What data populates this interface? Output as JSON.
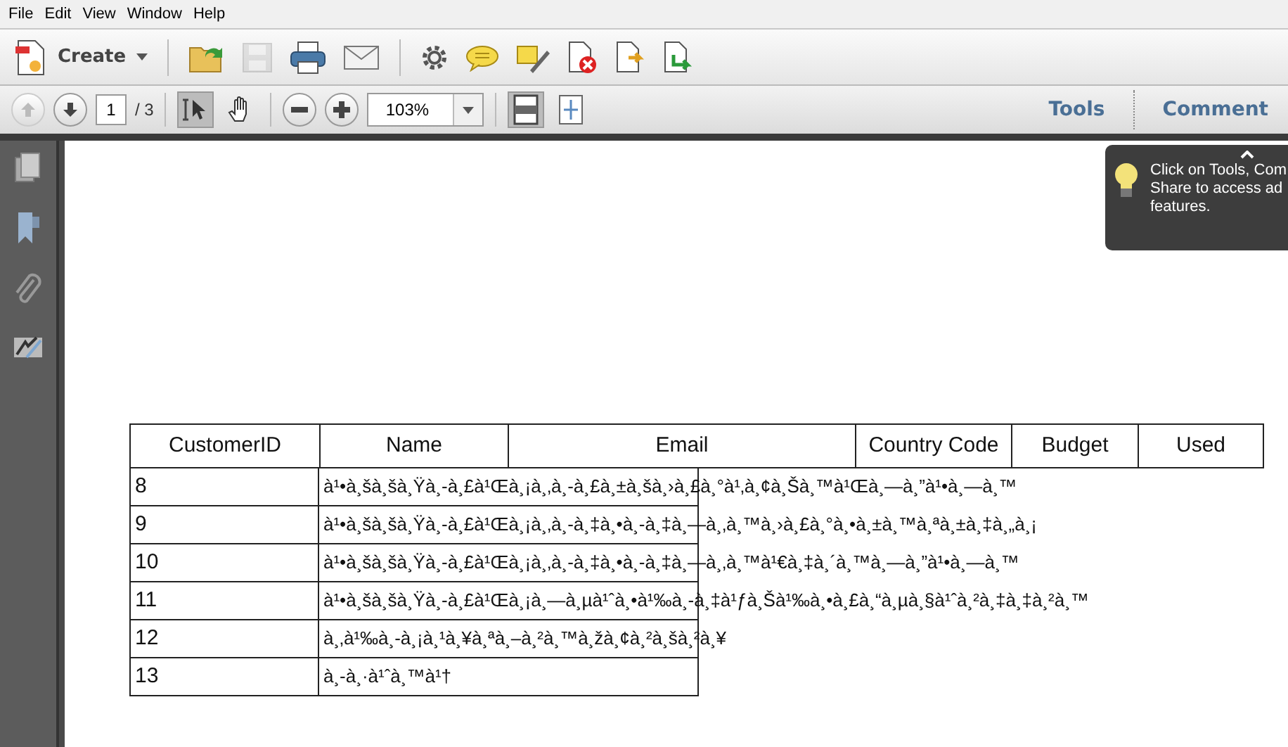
{
  "menu": [
    {
      "label": "File"
    },
    {
      "label": "Edit"
    },
    {
      "label": "View"
    },
    {
      "label": "Window"
    },
    {
      "label": "Help"
    }
  ],
  "toolbar": {
    "create_label": "Create",
    "save": {
      "disabled": true
    }
  },
  "navbar": {
    "prev_page": {
      "disabled": true
    },
    "page_current": "1",
    "page_total": "/ 3",
    "zoom": "103%",
    "tools": [
      {
        "kind": "select",
        "selected": true
      },
      {
        "kind": "hand",
        "selected": false
      }
    ],
    "view_buttons": [
      {
        "kind": "single-page",
        "selected": true
      },
      {
        "kind": "fit-page",
        "selected": false
      }
    ],
    "panes": [
      {
        "label": "Tools"
      },
      {
        "label": "Comment"
      }
    ]
  },
  "tooltip": {
    "lines": [
      "Click on Tools, Com",
      "Share to access ad",
      "features."
    ]
  },
  "table": {
    "columns": [
      "CustomerID",
      "Name",
      "Email",
      "Country Code",
      "Budget",
      "Used"
    ],
    "rows": [
      {
        "id": "8",
        "name": "à¹•à¸šà¸šà¸Ÿà¸-à¸£à¹Œà¸¡à¸‚à¸-à¸£à¸±à¸šà¸›à¸£à¸°à¹‚à¸¢à¸Šà¸™à¹Œà¸—à¸”à¹•à¸—à¸™"
      },
      {
        "id": "9",
        "name": "à¹•à¸šà¸šà¸Ÿà¸-à¸£à¹Œà¸¡à¸‚à¸-à¸‡à¸•à¸-à¸‡à¸—à¸‚à¸™à¸›à¸£à¸°à¸•à¸±à¸™à¸ªà¸±à¸‡à¸„à¸¡"
      },
      {
        "id": "10",
        "name": "à¹•à¸šà¸šà¸Ÿà¸-à¸£à¹Œà¸¡à¸‚à¸-à¸‡à¸•à¸-à¸‡à¸—à¸‚à¸™à¹€à¸‡à¸´à¸™à¸—à¸”à¹•à¸—à¸™"
      },
      {
        "id": "11",
        "name": "à¹•à¸šà¸šà¸Ÿà¸-à¸£à¹Œà¸¡à¸—à¸µà¹ˆà¸•à¹‰à¸-à¸‡à¹ƒà¸Šà¹‰à¸•à¸£à¸“à¸µà¸§à¹ˆà¸²à¸‡à¸‡à¸²à¸™"
      },
      {
        "id": "12",
        "name": "à¸‚à¹‰à¸-à¸¡à¸¹à¸¥à¸ªà¸–à¸²à¸™à¸žà¸¢à¸²à¸šà¸²à¸¥"
      },
      {
        "id": "13",
        "name": "à¸-à¸·à¹ˆà¸™à¹†"
      }
    ]
  }
}
